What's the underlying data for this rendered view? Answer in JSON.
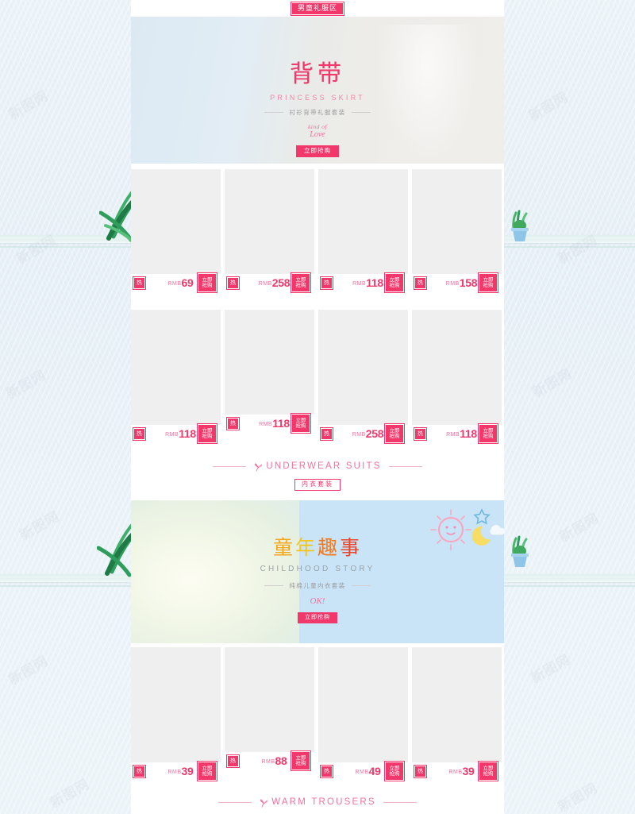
{
  "page": {
    "top_badge": "男童礼服区",
    "watermark": "新图网"
  },
  "banner1": {
    "title": "背带",
    "subtitle": "PRINCESS SKIRT",
    "tagline": "衬衫背带礼服套装",
    "script_line1": "kind of",
    "script_line2": "Love",
    "button": "立即抢购"
  },
  "banner2": {
    "title_chars": [
      "童",
      "年",
      "趣",
      "事"
    ],
    "title_colors": [
      "#f3a81e",
      "#f5c518",
      "#f07a22",
      "#e8472c"
    ],
    "subtitle": "CHILDHOOD STORY",
    "tagline": "纯棉儿童内衣套装",
    "script": "OK!",
    "button": "立即抢购"
  },
  "labels": {
    "currency": "RMB",
    "hot": "热",
    "buy_line1": "立即",
    "buy_line2": "抢购"
  },
  "sections": [
    {
      "title": "UNDERWEAR SUITS",
      "badge": "内衣套装"
    },
    {
      "title": "WARM TROUSERS",
      "badge": ""
    }
  ],
  "rows": [
    {
      "products": [
        {
          "price": "69",
          "hot": "热"
        },
        {
          "price": "258",
          "hot": "热"
        },
        {
          "price": "118",
          "hot": "热"
        },
        {
          "price": "158",
          "hot": "热"
        }
      ]
    },
    {
      "products": [
        {
          "price": "118",
          "hot": "热"
        },
        {
          "price": "118",
          "hot": "热"
        },
        {
          "price": "258",
          "hot": "热"
        },
        {
          "price": "118",
          "hot": "热"
        }
      ]
    },
    {
      "products": [
        {
          "price": "39",
          "hot": "热"
        },
        {
          "price": "88",
          "hot": "热"
        },
        {
          "price": "49",
          "hot": "热"
        },
        {
          "price": "39",
          "hot": "热"
        }
      ]
    }
  ],
  "colors": {
    "accent_pink": "#f2386b",
    "light_pink": "#f2719a",
    "card_gray": "#efefef",
    "page_bg": "#eaf2f8",
    "banner2_blue": "#c9e3f7"
  }
}
